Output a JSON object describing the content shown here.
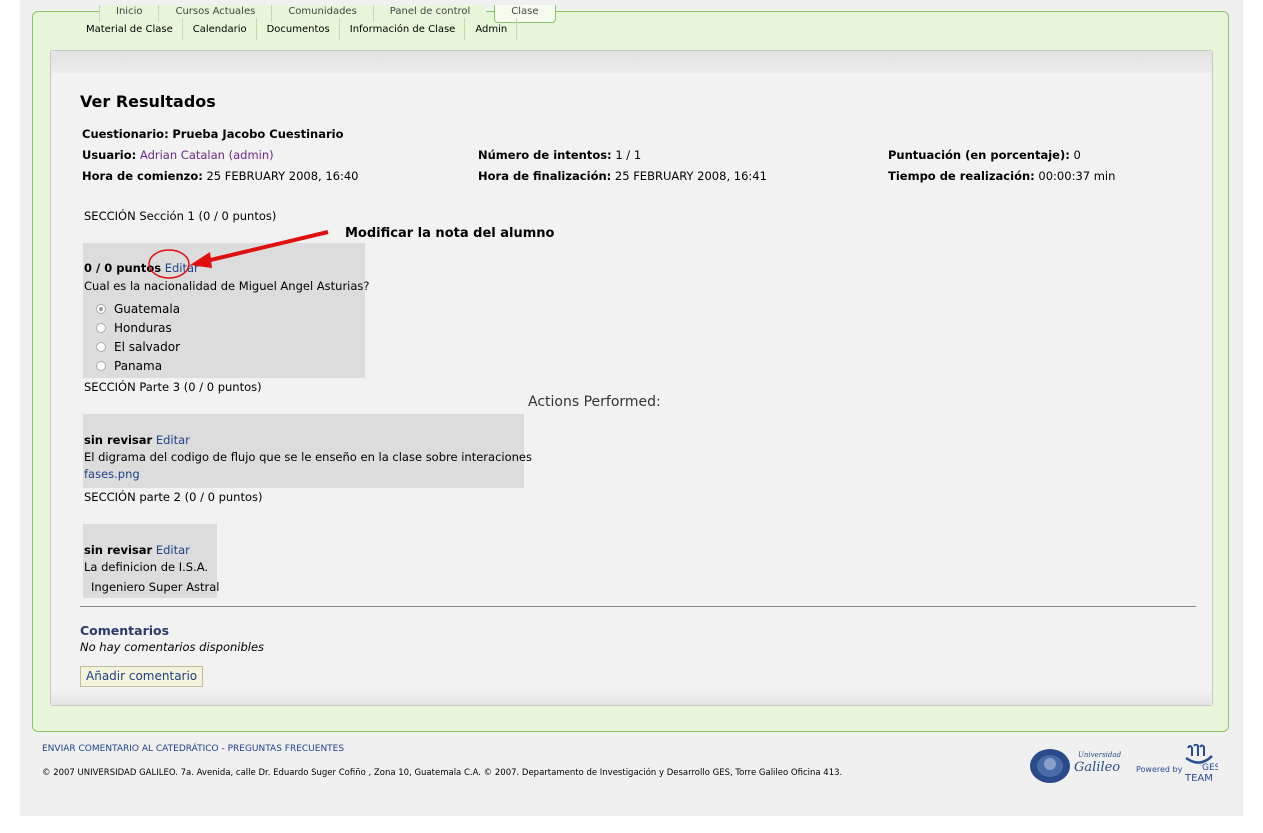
{
  "top_tabs": [
    "Inicio",
    "Cursos Actuales",
    "Comunidades",
    "Panel de control",
    "Clase"
  ],
  "subnav": [
    "Material de Clase",
    "Calendario",
    "Documentos",
    "Información de Clase",
    "Admin"
  ],
  "page_title": "Ver Resultados",
  "info": {
    "quiz_label": "Cuestionario:",
    "quiz_value": "Prueba Jacobo Cuestinario",
    "user_label": "Usuario:",
    "user_value": "Adrian Catalan (admin)",
    "attempts_label": "Número de intentos:",
    "attempts_value": "1 / 1",
    "score_label": "Puntuación (en porcentaje):",
    "score_value": "0",
    "start_label": "Hora de comienzo:",
    "start_value": "25 FEBRUARY 2008, 16:40",
    "end_label": "Hora de finalización:",
    "end_value": "25 FEBRUARY 2008, 16:41",
    "duration_label": "Tiempo de realización:",
    "duration_value": "00:00:37 min"
  },
  "annotation": "Modificar la nota del alumno",
  "actions_performed": "Actions Performed:",
  "sections": {
    "s1": "SECCIÓN Sección 1 (0 / 0 puntos)",
    "s2": "SECCIÓN Parte 3 (0 / 0 puntos)",
    "s3": "SECCIÓN parte 2 (0 / 0 puntos)"
  },
  "q1": {
    "score": "0 / 0 puntos",
    "edit": "Editar",
    "text": "Cual es la nacionalidad de Miguel Angel Asturias?",
    "options": [
      "Guatemala",
      "Honduras",
      "El salvador",
      "Panama"
    ],
    "selected_index": 0
  },
  "q2": {
    "status": "sin revisar",
    "edit": "Editar",
    "text": "El digrama del codigo de flujo que se le enseño en la clase sobre interaciones",
    "file": "fases.png"
  },
  "q3": {
    "status": "sin revisar",
    "edit": "Editar",
    "text": "La definicion de I.S.A.",
    "answer": "Ingeniero Super Astral"
  },
  "comments": {
    "heading": "Comentarios",
    "empty": "No hay comentarios disponibles",
    "add_button": "Añadir comentario"
  },
  "footer": {
    "links": "ENVIAR COMENTARIO AL CATEDRÁTICO - PREGUNTAS FRECUENTES",
    "copyright": "© 2007 UNIVERSIDAD GALILEO. 7a. Avenida, calle Dr. Eduardo Suger Cofiño , Zona 10, Guatemala C.A. © 2007. Departamento de Investigación y Desarrollo GES, Torre Galileo Oficina 413.",
    "powered_by": "Powered by"
  },
  "logos": {
    "university_line1": "Universidad",
    "university_line2": "Galileo",
    "team": "TEAM"
  },
  "colors": {
    "accent_green": "#8cc466",
    "link_blue": "#1f3f8a",
    "annotation_red": "#e01010"
  }
}
